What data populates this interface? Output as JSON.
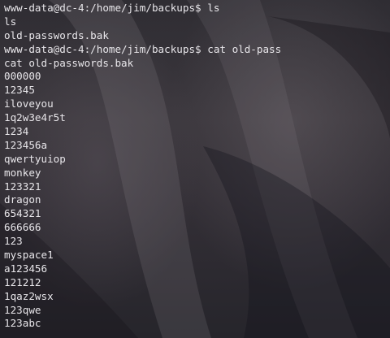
{
  "terminal": {
    "lines": [
      {
        "kind": "prompt",
        "prompt": "www-data@dc-4:/home/jim/backups$",
        "command": "ls"
      },
      {
        "kind": "output",
        "text": "ls"
      },
      {
        "kind": "output",
        "text": "old-passwords.bak"
      },
      {
        "kind": "prompt",
        "prompt": "www-data@dc-4:/home/jim/backups$",
        "command": "cat old-pass"
      },
      {
        "kind": "output",
        "text": "cat old-passwords.bak"
      },
      {
        "kind": "output",
        "text": "000000"
      },
      {
        "kind": "output",
        "text": "12345"
      },
      {
        "kind": "output",
        "text": "iloveyou"
      },
      {
        "kind": "output",
        "text": "1q2w3e4r5t"
      },
      {
        "kind": "output",
        "text": "1234"
      },
      {
        "kind": "output",
        "text": "123456a"
      },
      {
        "kind": "output",
        "text": "qwertyuiop"
      },
      {
        "kind": "output",
        "text": "monkey"
      },
      {
        "kind": "output",
        "text": "123321"
      },
      {
        "kind": "output",
        "text": "dragon"
      },
      {
        "kind": "output",
        "text": "654321"
      },
      {
        "kind": "output",
        "text": "666666"
      },
      {
        "kind": "output",
        "text": "123"
      },
      {
        "kind": "output",
        "text": "myspace1"
      },
      {
        "kind": "output",
        "text": "a123456"
      },
      {
        "kind": "output",
        "text": "121212"
      },
      {
        "kind": "output",
        "text": "1qaz2wsx"
      },
      {
        "kind": "output",
        "text": "123qwe"
      },
      {
        "kind": "output",
        "text": "123abc"
      }
    ]
  },
  "colors": {
    "text": "#e8e6ea",
    "background": "#2b2a30"
  }
}
